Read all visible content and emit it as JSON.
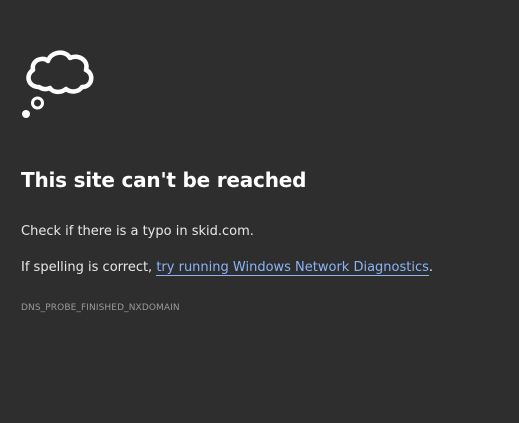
{
  "icon": {
    "name": "thought-cloud-icon",
    "color": "#ffffff"
  },
  "error": {
    "title": "This site can't be reached",
    "typo_text_prefix": "Check if there is a typo in ",
    "domain": "skid.com",
    "typo_text_suffix": ".",
    "spelling_prefix": "If spelling is correct, ",
    "diagnostics_link": "try running Windows Network Diagnostics",
    "spelling_suffix": ".",
    "code": "DNS_PROBE_FINISHED_NXDOMAIN"
  },
  "colors": {
    "background": "#2e2e2e",
    "text": "#e8e8e8",
    "link": "#8ab4f8",
    "muted": "#9a9a9a"
  }
}
